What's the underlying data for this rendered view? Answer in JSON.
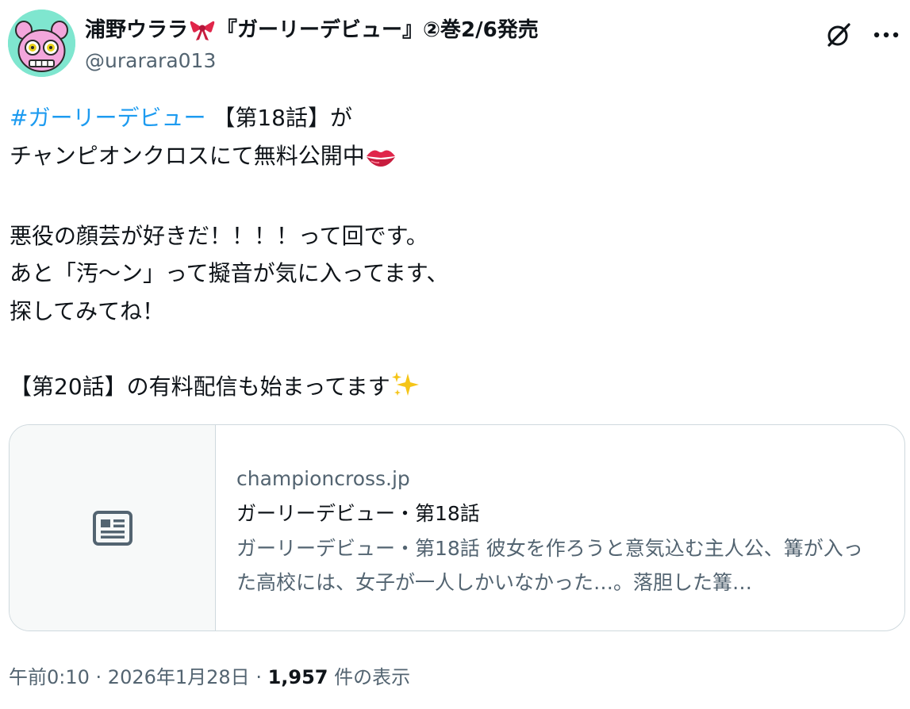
{
  "author": {
    "display_name_prefix": "浦野ウララ",
    "display_name_suffix": "『ガーリーデビュー』②巻2/6発売",
    "handle": "@urarara013",
    "avatar_color": "#7fe6cf"
  },
  "tweet": {
    "hashtag": "#ガーリーデビュー",
    "line1_rest": " 【第18話】が",
    "line2": "チャンピオンクロスにて無料公開中",
    "line3": "",
    "line4": "悪役の顔芸が好きだ！！！！って回です。",
    "line5": "あと「汚〜ン」って擬音が気に入ってます、",
    "line6": "探してみてね！",
    "line7": "",
    "line8": "【第20話】の有料配信も始まってます"
  },
  "card": {
    "domain": "championcross.jp",
    "title": "ガーリーデビュー・第18話",
    "description": "ガーリーデビュー・第18話 彼女を作ろうと意気込む主人公、篝が入った高校には、女子が一人しかいなかった…。落胆した篝…"
  },
  "meta": {
    "time": "午前0:10",
    "separator1": " · ",
    "date": "2026年1月28日",
    "separator2": " · ",
    "view_count": "1,957",
    "view_label": " 件の表示"
  },
  "icons": {
    "grok": "grok-icon",
    "more": "more-icon",
    "card_thumb": "article-icon",
    "ribbon": "ribbon-icon",
    "lips": "lips-icon",
    "sparkles": "sparkles-icon"
  },
  "colors": {
    "hashtag": "#1d9bf0",
    "secondary_text": "#536471",
    "border": "#cfd9de"
  }
}
